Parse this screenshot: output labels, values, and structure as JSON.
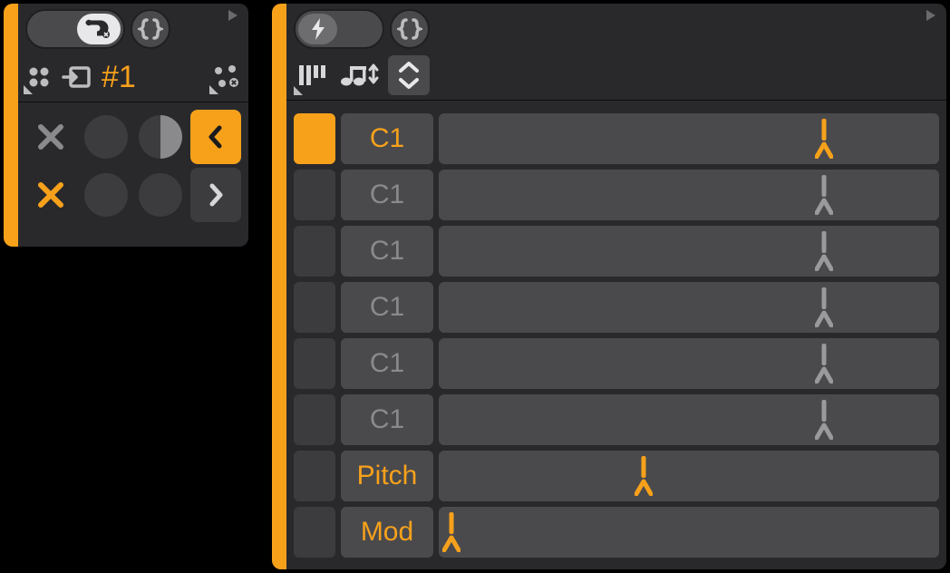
{
  "colors": {
    "accent": "#f7a11b",
    "panel": "#29292c",
    "cell": "#3c3c3f",
    "pill": "#4a4a4d",
    "dim": "#8a8a8d",
    "light": "#e8e8ea"
  },
  "left": {
    "pattern_label": "#1",
    "icons": {
      "route": "route-icon",
      "braces": "braces-icon",
      "dots4": "dots4-icon",
      "input": "input-icon",
      "dots4x": "dots4-random-icon"
    },
    "grid": [
      {
        "type": "x",
        "color": "dim"
      },
      {
        "type": "circle"
      },
      {
        "type": "half"
      },
      {
        "type": "chev-left",
        "accent": true
      },
      {
        "type": "x",
        "color": "orange"
      },
      {
        "type": "circle"
      },
      {
        "type": "circle"
      },
      {
        "type": "chev-right"
      }
    ]
  },
  "right": {
    "icons": {
      "bolt": "bolt-icon",
      "braces": "braces-icon",
      "bars": "bars-icon",
      "note-arrows": "note-updown-icon",
      "expand-v": "expand-vertical-icon"
    },
    "tracks": [
      {
        "selected": true,
        "label": "C1",
        "label_color": "orange",
        "marker_pct": 77,
        "marker_color": "orange"
      },
      {
        "selected": false,
        "label": "C1",
        "label_color": "dim",
        "marker_pct": 77,
        "marker_color": "grey"
      },
      {
        "selected": false,
        "label": "C1",
        "label_color": "dim",
        "marker_pct": 77,
        "marker_color": "grey"
      },
      {
        "selected": false,
        "label": "C1",
        "label_color": "dim",
        "marker_pct": 77,
        "marker_color": "grey"
      },
      {
        "selected": false,
        "label": "C1",
        "label_color": "dim",
        "marker_pct": 77,
        "marker_color": "grey"
      },
      {
        "selected": false,
        "label": "C1",
        "label_color": "dim",
        "marker_pct": 77,
        "marker_color": "grey"
      },
      {
        "selected": false,
        "label": "Pitch",
        "label_color": "orange",
        "marker_pct": 41,
        "marker_color": "orange"
      },
      {
        "selected": false,
        "label": "Mod",
        "label_color": "orange",
        "marker_pct": 2.5,
        "marker_color": "orange"
      }
    ]
  }
}
